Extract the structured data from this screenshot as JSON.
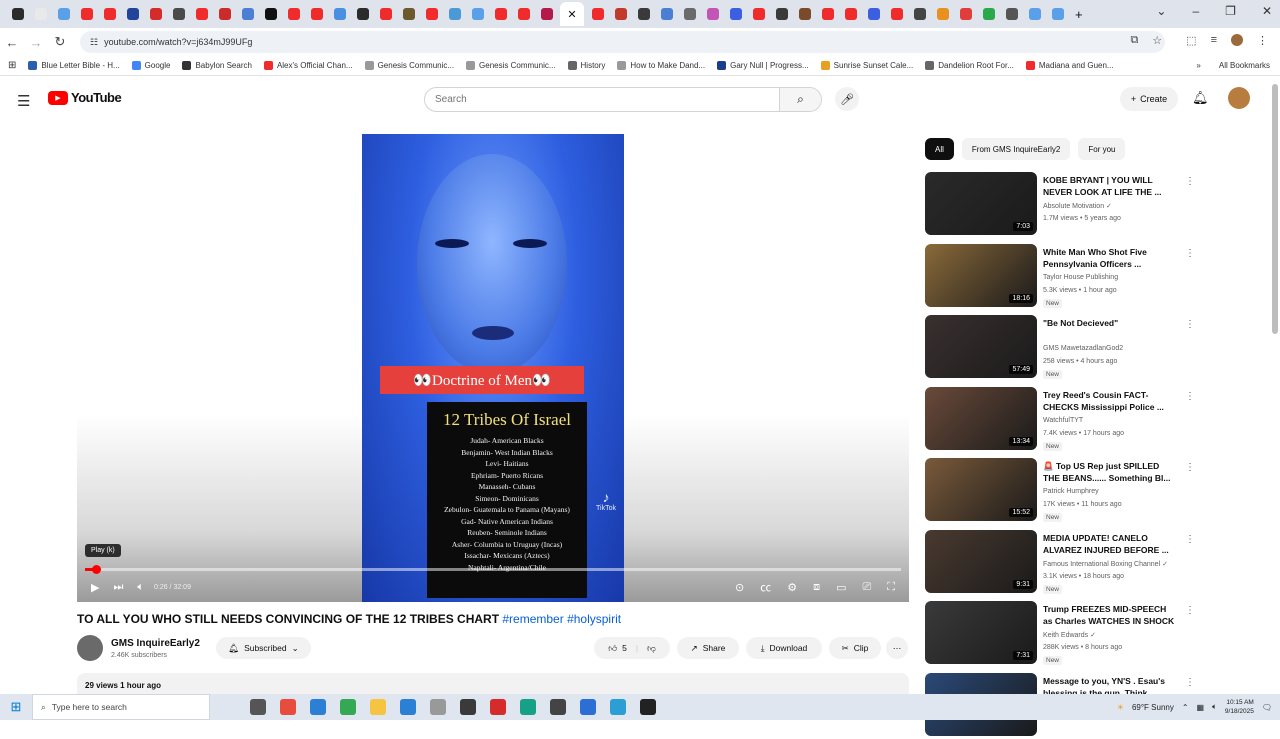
{
  "browser": {
    "url": "youtube.com/watch?v=j634mJ99UFg",
    "tab_colors": [
      "#2b2b2b",
      "#e9e9e9",
      "#5aa0e8",
      "#ef2b2b",
      "#ef2b2b",
      "#22449a",
      "#d42b2b",
      "#4a4a4a",
      "#ef2b2b",
      "#cc2b2b",
      "#4a7fd4",
      "#111111",
      "#ef2b2b",
      "#ef2b2b",
      "#4a8fe0",
      "#2b2b2b",
      "#ef2b2b",
      "#6b5a2b",
      "#ef2b2b",
      "#4a9ad8",
      "#5aa0e8",
      "#ef2b2b",
      "#ef2b2b",
      "#b5184a"
    ],
    "tab_colors_after": [
      "#ef2b2b",
      "#c0392b",
      "#3a3a3a",
      "#4a7fd4",
      "#6a6a6a",
      "#c255b5",
      "#3b5fe0",
      "#ef2b2b",
      "#3a3a3a",
      "#7a4a2b",
      "#ef2b2b",
      "#ef2b2b",
      "#3b5fe0",
      "#ef2b2b",
      "#444444",
      "#e89020",
      "#e23d3d",
      "#2aa84a",
      "#555555",
      "#5aa0e8",
      "#5aa0e8"
    ],
    "active_tab_icon": "✕",
    "new_tab": "+",
    "window_controls": [
      "⌄",
      "–",
      "❐",
      "✕"
    ],
    "bookmarks": [
      {
        "label": "Blue Letter Bible - H...",
        "color": "#2b5fae"
      },
      {
        "label": "Google",
        "color": "#4285f4"
      },
      {
        "label": "Babylon Search",
        "color": "#333333"
      },
      {
        "label": "Alex's Official Chan...",
        "color": "#ef2b2b"
      },
      {
        "label": "Genesis Communic...",
        "color": "#999999"
      },
      {
        "label": "Genesis Communic...",
        "color": "#999999"
      },
      {
        "label": "History",
        "color": "#666666"
      },
      {
        "label": "How to Make Dand...",
        "color": "#999999"
      },
      {
        "label": "Gary Null | Progress...",
        "color": "#1a3e8a"
      },
      {
        "label": "Sunrise Sunset Cale...",
        "color": "#e8a020"
      },
      {
        "label": "Dandelion Root For...",
        "color": "#666666"
      },
      {
        "label": "Madiana and Guen...",
        "color": "#ef2b2b"
      }
    ],
    "bookmarks_more": "»",
    "all_bookmarks": "All Bookmarks"
  },
  "header": {
    "logo_text": "YouTube",
    "search_placeholder": "Search",
    "create_label": "Create"
  },
  "player": {
    "doctrine_label": "👀Doctrine of Men👀",
    "tribes_title": "12 Tribes Of Israel",
    "tribes": [
      "Judah- American Blacks",
      "Benjamin- West Indian Blacks",
      "Levi- Haitians",
      "Ephriam- Puerto Ricans",
      "Manasseh- Cubans",
      "Simeon- Dominicans",
      "Zebulon- Guatemala to Panama (Mayans)",
      "Gad- Native American Indians",
      "Reuben- Seminole Indians",
      "Asher- Columbia to Uruguay (Incas)",
      "Issachar- Mexicans (Aztecs)",
      "Naphtali- Argentina/Chile"
    ],
    "tiktok_label": "TikTok",
    "tiktok_handle": "@...",
    "tooltip": "Play (k)",
    "time": "0:26 / 32:09",
    "progress": 0.014
  },
  "video": {
    "title_text": "TO ALL YOU WHO STILL NEEDS CONVINCING OF THE 12 TRIBES CHART ",
    "title_tags": "#remember #holyspirit",
    "channel_name": "GMS InquireEarly2",
    "subscribers": "2.46K subscribers",
    "subscribed_label": "Subscribed",
    "like_count": "5",
    "share_label": "Share",
    "download_label": "Download",
    "clip_label": "Clip",
    "views_line": "29 views  1 hour ago"
  },
  "sidebar": {
    "chips": [
      "All",
      "From GMS InquireEarly2",
      "For you"
    ],
    "recs": [
      {
        "title": "KOBE BRYANT | YOU WILL NEVER LOOK AT LIFE THE ...",
        "channel": "Absolute Motivation ✓",
        "meta": "1.7M views • 5 years ago",
        "duration": "7:03",
        "new": "",
        "thumb": "#2a2a2a"
      },
      {
        "title": "White Man Who Shot Five Pennsylvania Officers ...",
        "channel": "Taylor House Publishing",
        "meta": "5.3K views • 1 hour ago",
        "duration": "18:16",
        "new": "New",
        "thumb": "#8a6a3a"
      },
      {
        "title": "\"Be Not Decieved\"",
        "channel": "GMS MawetazadlanGod2",
        "meta": "258 views • 4 hours ago",
        "duration": "57:49",
        "new": "New",
        "thumb": "#3a3030"
      },
      {
        "title": "Trey Reed's Cousin FACT-CHECKS Mississippi Police ...",
        "channel": "WatchfulTYT",
        "meta": "7.4K views • 17 hours ago",
        "duration": "13:34",
        "new": "New",
        "thumb": "#6a4a3a"
      },
      {
        "title": "🚨 Top US Rep just SPILLED THE BEANS...... Something Bl...",
        "channel": "Patrick Humphrey",
        "meta": "17K views • 11 hours ago",
        "duration": "15:52",
        "new": "New",
        "thumb": "#7a5a3a"
      },
      {
        "title": "MEDIA UPDATE! CANELO ALVAREZ INJURED BEFORE ...",
        "channel": "Famous International Boxing Channel ✓",
        "meta": "3.1K views • 18 hours ago",
        "duration": "9:31",
        "new": "New",
        "thumb": "#4a3a30"
      },
      {
        "title": "Trump FREEZES MID-SPEECH as Charles WATCHES IN SHOCK",
        "channel": "Keith Edwards ✓",
        "meta": "288K views • 8 hours ago",
        "duration": "7:31",
        "new": "New",
        "thumb": "#3a3a3a"
      },
      {
        "title": "Message to you, YN'S . Esau's blessing is the gun. Think ...",
        "channel": "",
        "meta": "",
        "duration": "",
        "new": "",
        "thumb": "#2a4a7a"
      }
    ]
  },
  "taskbar": {
    "search_placeholder": "Type here to search",
    "weather": "69°F  Sunny",
    "time": "10:15 AM",
    "date": "9/18/2025",
    "app_colors": [
      "#555555",
      "#e84c3d",
      "#2b7fd4",
      "#34a853",
      "#f5c542",
      "#2b7fd4",
      "#999999",
      "#3a3a3a",
      "#d62b2b",
      "#16a085",
      "#444444",
      "#2b6fd4",
      "#2b9fd4",
      "#222222"
    ]
  }
}
